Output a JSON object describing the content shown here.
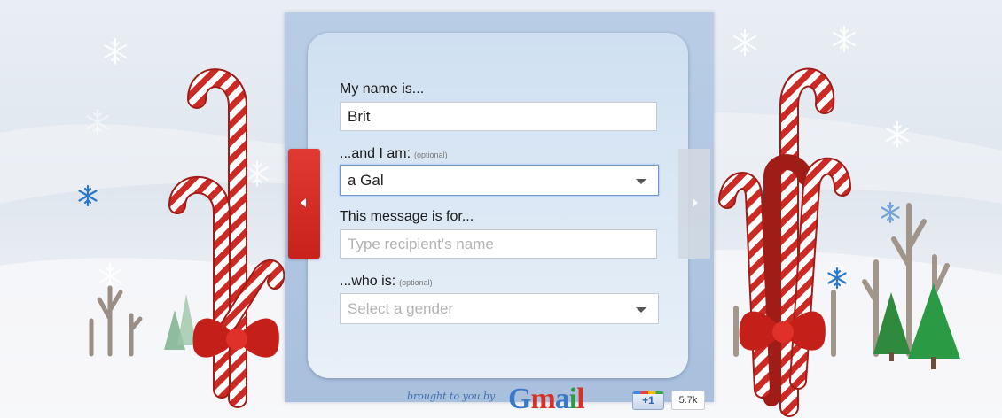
{
  "form": {
    "name_label": "My name is...",
    "name_value": "Brit",
    "sender_gender_label": "...and I am:",
    "sender_gender_optional": "(optional)",
    "sender_gender_value": "a Gal",
    "recipient_label": "This message is for...",
    "recipient_placeholder": "Type recipient's name",
    "recipient_gender_label": "...who is:",
    "recipient_gender_optional": "(optional)",
    "recipient_gender_placeholder": "Select a gender"
  },
  "footer": {
    "brought_by": "brought to you by",
    "logo_text": "Gmail",
    "plusone_label": "+1",
    "plusone_count": "5.7k"
  },
  "icons": {
    "nav_prev": "chevron-left-icon",
    "nav_next": "chevron-right-icon",
    "dropdown": "caret-down-icon",
    "decoration": [
      "snowflake-icon",
      "candy-cane-icon",
      "bow-icon",
      "tree-icon"
    ]
  },
  "colors": {
    "accent_red": "#d42a22",
    "panel_blue": "#b9cde6",
    "gmail_blue": "#3b6fb0"
  }
}
